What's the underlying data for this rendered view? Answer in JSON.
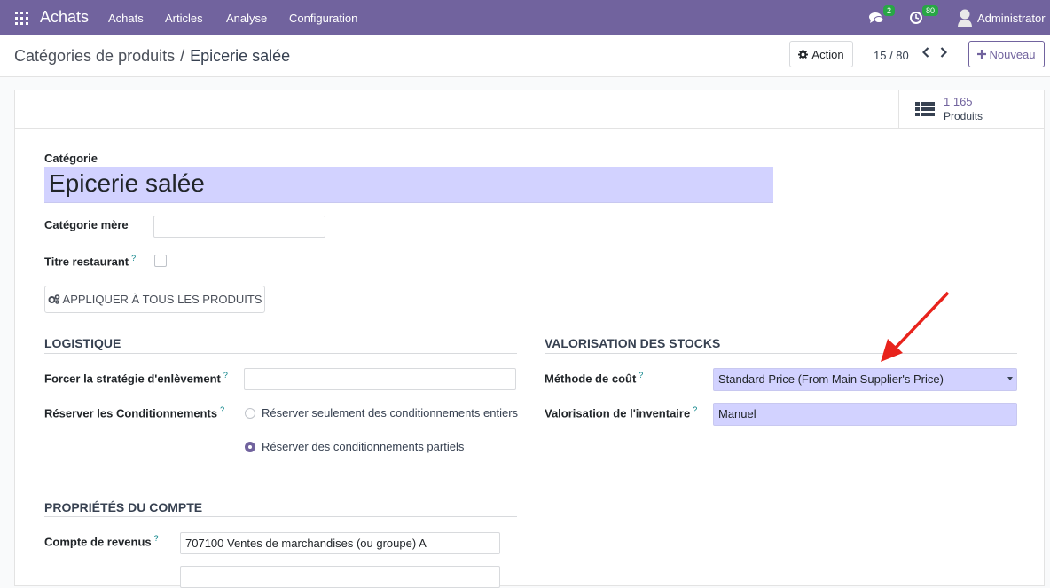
{
  "navbar": {
    "app_name": "Achats",
    "menu": [
      "Achats",
      "Articles",
      "Analyse",
      "Configuration"
    ],
    "messages_count": "2",
    "activities_count": "80",
    "user": "Administrator",
    "bg_color": "#71639e",
    "badge_color": "#28a745"
  },
  "control_panel": {
    "breadcrumb_parent": "Catégories de produits",
    "breadcrumb_separator": "/",
    "breadcrumb_current": "Epicerie salée",
    "action_label": "Action",
    "pager_value": "15 / 80",
    "new_label": "Nouveau"
  },
  "smart_button": {
    "value": "1 165",
    "label": "Produits",
    "icon": "list-icon"
  },
  "form": {
    "category_label": "Catégorie",
    "category_name": "Epicerie salée",
    "parent_label": "Catégorie mère",
    "parent_value": "",
    "restaurant_label": "Titre restaurant",
    "help_mark": "?",
    "apply_button": "APPLIQUER À TOUS LES PRODUITS"
  },
  "logistics": {
    "title": "LOGISTIQUE",
    "removal_label": "Forcer la stratégie d'enlèvement",
    "removal_value": "",
    "packaging_label": "Réserver les Conditionnements",
    "option_full": "Réserver seulement des conditionnements entiers",
    "option_partial": "Réserver des conditionnements partiels",
    "selected": "partial"
  },
  "valuation": {
    "title": "VALORISATION DES STOCKS",
    "cost_method_label": "Méthode de coût",
    "cost_method_value": "Standard Price (From Main Supplier's Price)",
    "inventory_label": "Valorisation de l'inventaire",
    "inventory_value": "Manuel"
  },
  "account": {
    "title": "PROPRIÉTÉS DU COMPTE",
    "income_label": "Compte de revenus",
    "income_value": "707100 Ventes de marchandises (ou groupe) A"
  },
  "colors": {
    "accent": "#71639e",
    "required_bg": "#d2d2ff",
    "arrow": "#e8231c"
  }
}
